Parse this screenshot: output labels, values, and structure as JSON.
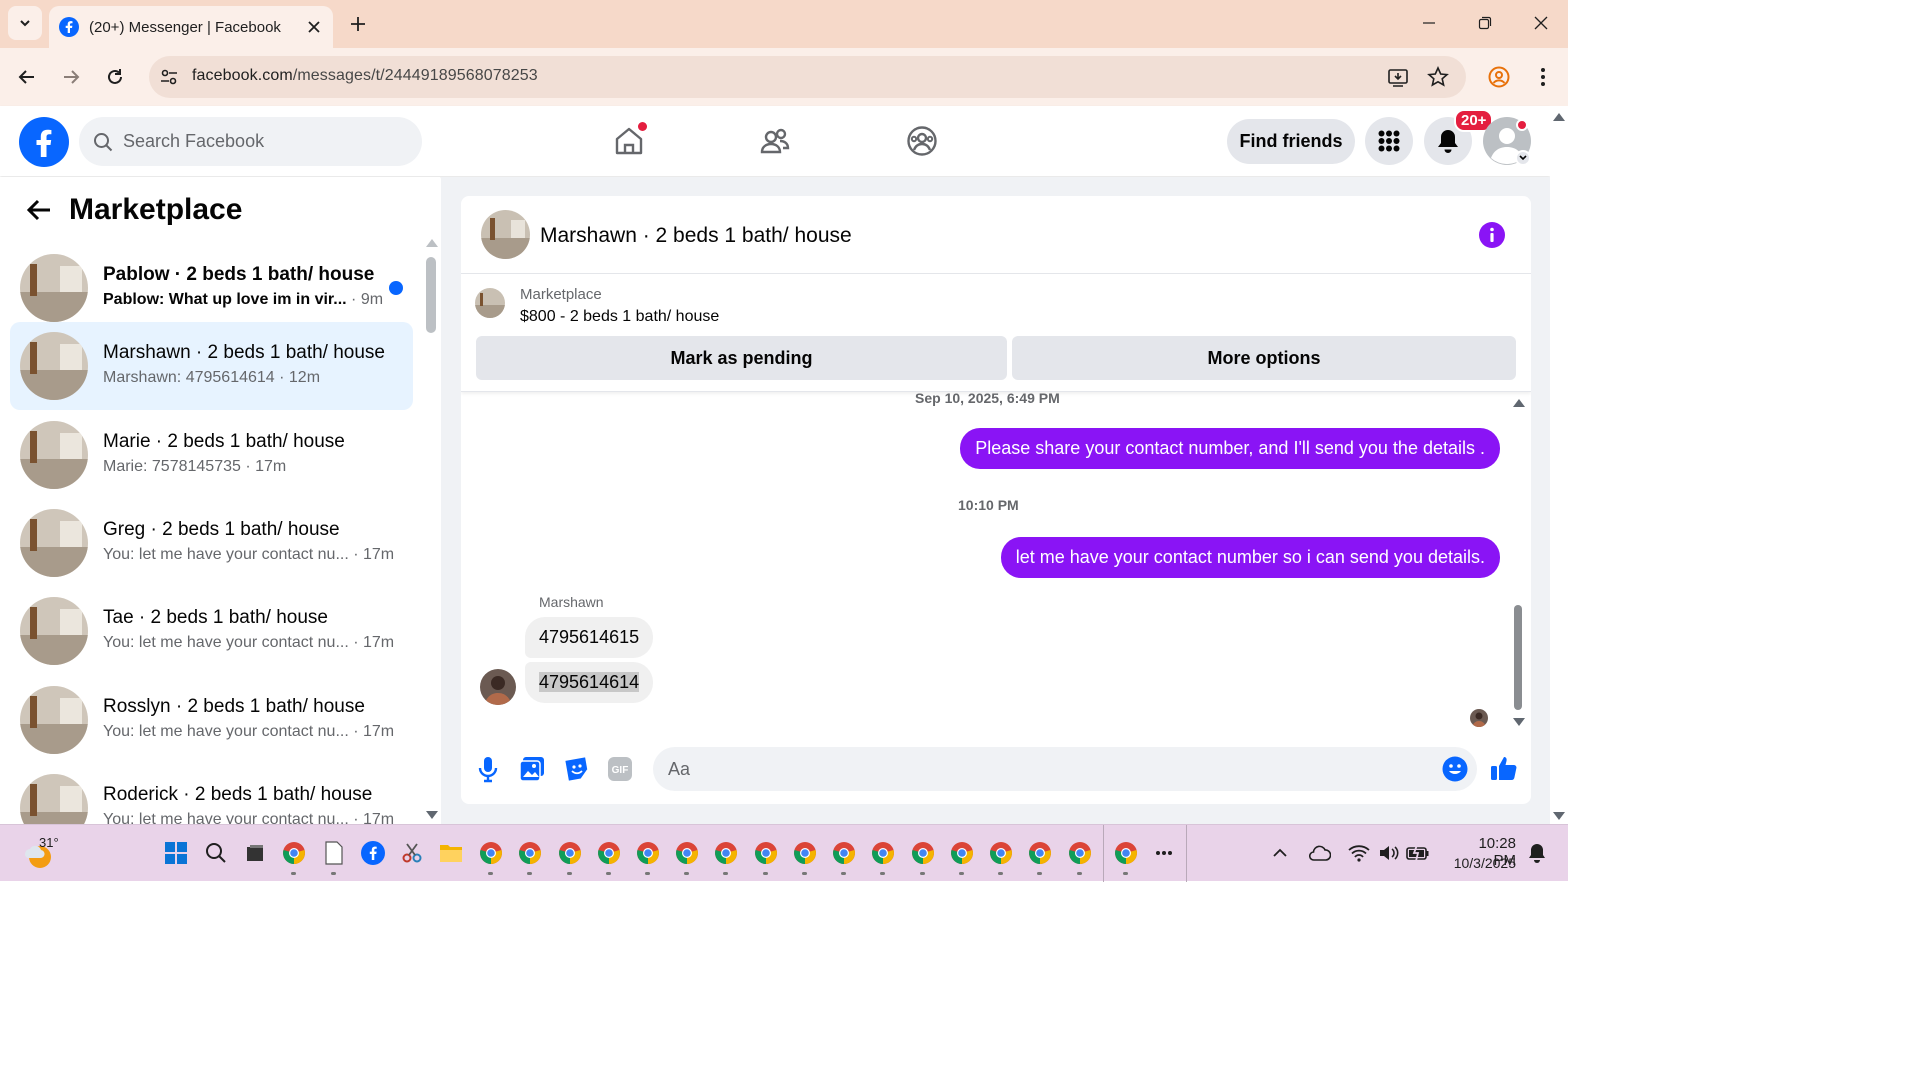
{
  "browser": {
    "tab_title": "(20+) Messenger | Facebook",
    "url_domain": "facebook.com",
    "url_path": "/messages/t/24449189568078253"
  },
  "header": {
    "search_placeholder": "Search Facebook",
    "find_friends": "Find friends",
    "notification_count": "20+"
  },
  "sidebar": {
    "title": "Marketplace",
    "conversations": [
      {
        "name": "Pablow · 2 beds 1 bath/ house",
        "preview": "Pablow: What up love im in vir...",
        "time": " · 9m",
        "unread": true,
        "active": false
      },
      {
        "name": "Marshawn · 2 beds 1 bath/ house",
        "preview": "Marshawn: 4795614614",
        "time": " · 12m",
        "unread": false,
        "active": true
      },
      {
        "name": "Marie · 2 beds 1 bath/ house",
        "preview": "Marie: 7578145735",
        "time": " · 17m",
        "unread": false,
        "active": false
      },
      {
        "name": "Greg · 2 beds 1 bath/ house",
        "preview": "You: let me have your contact nu...",
        "time": " · 17m",
        "unread": false,
        "active": false
      },
      {
        "name": "Tae · 2 beds 1 bath/ house",
        "preview": "You: let me have your contact nu...",
        "time": " · 17m",
        "unread": false,
        "active": false
      },
      {
        "name": "Rosslyn · 2 beds 1 bath/ house",
        "preview": "You: let me have your contact nu...",
        "time": " · 17m",
        "unread": false,
        "active": false
      },
      {
        "name": "Roderick · 2 beds 1 bath/ house",
        "preview": "You: let me have your contact nu...",
        "time": " · 17m",
        "unread": false,
        "active": false
      }
    ]
  },
  "chat": {
    "title": "Marshawn · 2 beds 1 bath/ house",
    "listing_label": "Marketplace",
    "listing_price": "$800 - 2 beds 1 bath/ house",
    "mark_pending": "Mark as pending",
    "more_options": "More options",
    "timestamp1": "Sep 10, 2025, 6:49 PM",
    "message_out1": "Please share your contact number, and I'll send you the details .",
    "timestamp2": "10:10 PM",
    "message_out2": "let me have your contact number so i can send you details.",
    "sender": "Marshawn",
    "message_in1": "4795614615",
    "message_in2": "4795614614",
    "composer_placeholder": "Aa"
  },
  "taskbar": {
    "weather_temp": "31°",
    "time": "10:28 PM",
    "date": "10/3/2025"
  },
  "colors": {
    "fb_blue": "#0866ff",
    "messenger_purple": "#8a14f5",
    "notification_red": "#e41e3f",
    "active_row": "#e7f3ff"
  }
}
